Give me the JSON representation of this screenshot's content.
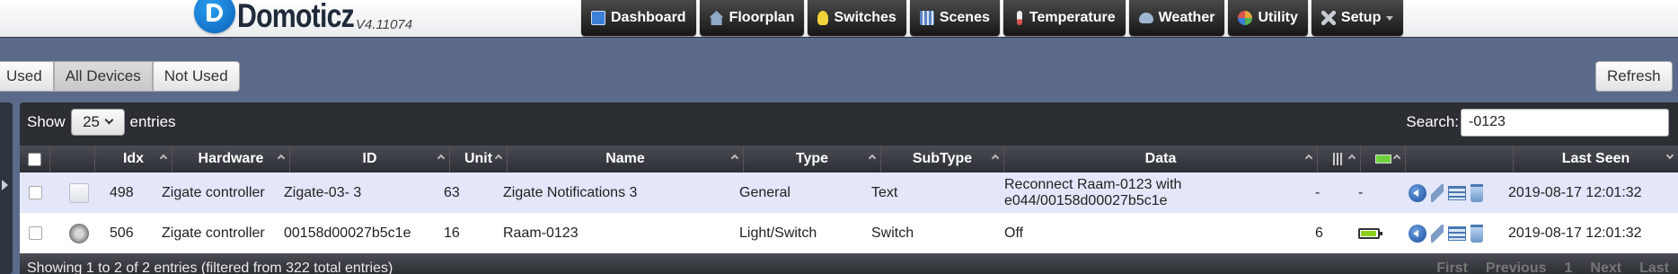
{
  "app": {
    "name": "Domoticz",
    "version": "V4.11074"
  },
  "nav": {
    "items": [
      {
        "label": "Dashboard",
        "icon": "dashboard-icon",
        "color": "#3b7fd6"
      },
      {
        "label": "Floorplan",
        "icon": "house-icon",
        "color": "#8fa9c8"
      },
      {
        "label": "Switches",
        "icon": "lightbulb-icon",
        "color": "#f2d23a"
      },
      {
        "label": "Scenes",
        "icon": "clapperboard-icon",
        "color": "#5a84c4"
      },
      {
        "label": "Temperature",
        "icon": "thermometer-icon",
        "color": "#d9534f"
      },
      {
        "label": "Weather",
        "icon": "cloud-rain-icon",
        "color": "#9fb6cf"
      },
      {
        "label": "Utility",
        "icon": "gauge-icon",
        "color": "#e8a33a"
      },
      {
        "label": "Setup",
        "icon": "tools-icon",
        "color": "#c8ccd2"
      }
    ]
  },
  "filters": {
    "used": "Used",
    "all": "All Devices",
    "not_used": "Not Used",
    "active": "All Devices"
  },
  "refresh_label": "Refresh",
  "table_controls": {
    "show_label": "Show",
    "entries_value": "25",
    "entries_label": "entries",
    "search_label": "Search:",
    "search_value": "-0123"
  },
  "columns": {
    "idx": "Idx",
    "hardware": "Hardware",
    "id": "ID",
    "unit": "Unit",
    "name": "Name",
    "type": "Type",
    "subtype": "SubType",
    "data": "Data",
    "signal_icon": "signal-level-icon",
    "battery_icon": "battery-level-icon",
    "last_seen": "Last Seen"
  },
  "rows": [
    {
      "icon": "text-device-icon",
      "idx": "498",
      "hardware": "Zigate controller",
      "id": "Zigate-03- 3",
      "unit": "63",
      "name": "Zigate Notifications 3",
      "type": "General",
      "subtype": "Text",
      "data": "Reconnect Raam-0123 with e044/00158d00027b5c1e",
      "signal": "-",
      "battery": "-",
      "last_seen": "2019-08-17 12:01:32"
    },
    {
      "icon": "switch-device-icon",
      "idx": "506",
      "hardware": "Zigate controller",
      "id": "00158d00027b5c1e",
      "unit": "16",
      "name": "Raam-0123",
      "type": "Light/Switch",
      "subtype": "Switch",
      "data": "Off",
      "signal": "6",
      "battery_level": 0.85,
      "last_seen": "2019-08-17 12:01:32"
    }
  ],
  "footer": {
    "info": "Showing 1 to 2 of 2 entries (filtered from 322 total entries)",
    "pager": {
      "first": "First",
      "previous": "Previous",
      "page": "1",
      "next": "Next",
      "last": "Last"
    }
  }
}
